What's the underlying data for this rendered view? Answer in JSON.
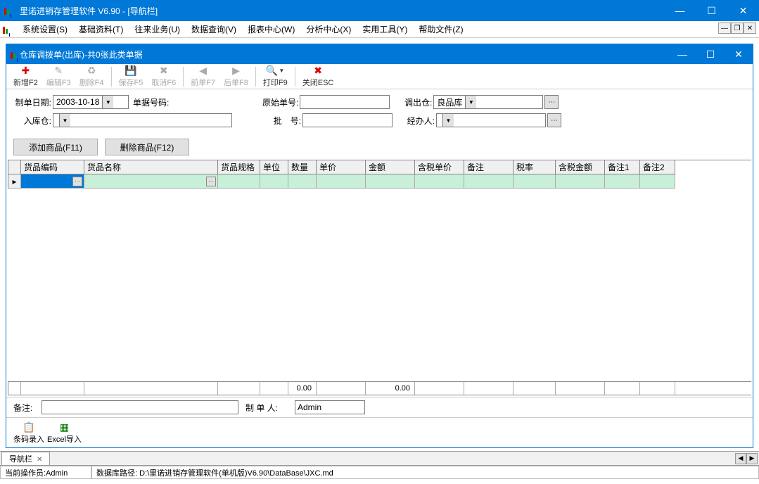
{
  "title": "里诺进销存管理软件 V6.90 - [导航栏]",
  "menu": [
    "系统设置(S)",
    "基础资料(T)",
    "往来业务(U)",
    "数据查询(V)",
    "报表中心(W)",
    "分析中心(X)",
    "实用工具(Y)",
    "帮助文件(Z)"
  ],
  "child_title": "仓库调拨单(出库)-共0张此类单据",
  "toolbar": {
    "new": "新增F2",
    "edit": "编辑F3",
    "delete": "删除F4",
    "save": "保存F5",
    "cancel": "取消F6",
    "prev": "前单F7",
    "next": "后单F8",
    "print": "打印F9",
    "close": "关闭ESC"
  },
  "form": {
    "date_label": "制单日期:",
    "date_value": "2003-10-18",
    "doc_no_label": "单据号码:",
    "original_label": "原始单号:",
    "out_wh_label": "调出仓:",
    "out_wh_value": "良品库",
    "in_wh_label": "入库仓:",
    "batch_label": "批　号:",
    "handler_label": "经办人:"
  },
  "buttons": {
    "add_product": "添加商品(F11)",
    "del_product": "删除商品(F12)"
  },
  "grid_headers": [
    "货品编码",
    "货品名称",
    "货品规格",
    "单位",
    "数量",
    "单价",
    "金额",
    "含税单价",
    "备注",
    "税率",
    "含税金额",
    "备注1",
    "备注2"
  ],
  "totals": {
    "qty": "0.00",
    "amount": "0.00"
  },
  "footer": {
    "remark_label": "备注:",
    "maker_label": "制 单 人:",
    "maker_value": "Admin",
    "barcode": "条码录入",
    "excel": "Excel导入"
  },
  "tab": "导航栏",
  "status": {
    "operator": "当前操作员:Admin",
    "dbpath": "数据库路径: D:\\里诺进销存管理软件(单机版)V6.90\\DataBase\\JXC.md"
  }
}
